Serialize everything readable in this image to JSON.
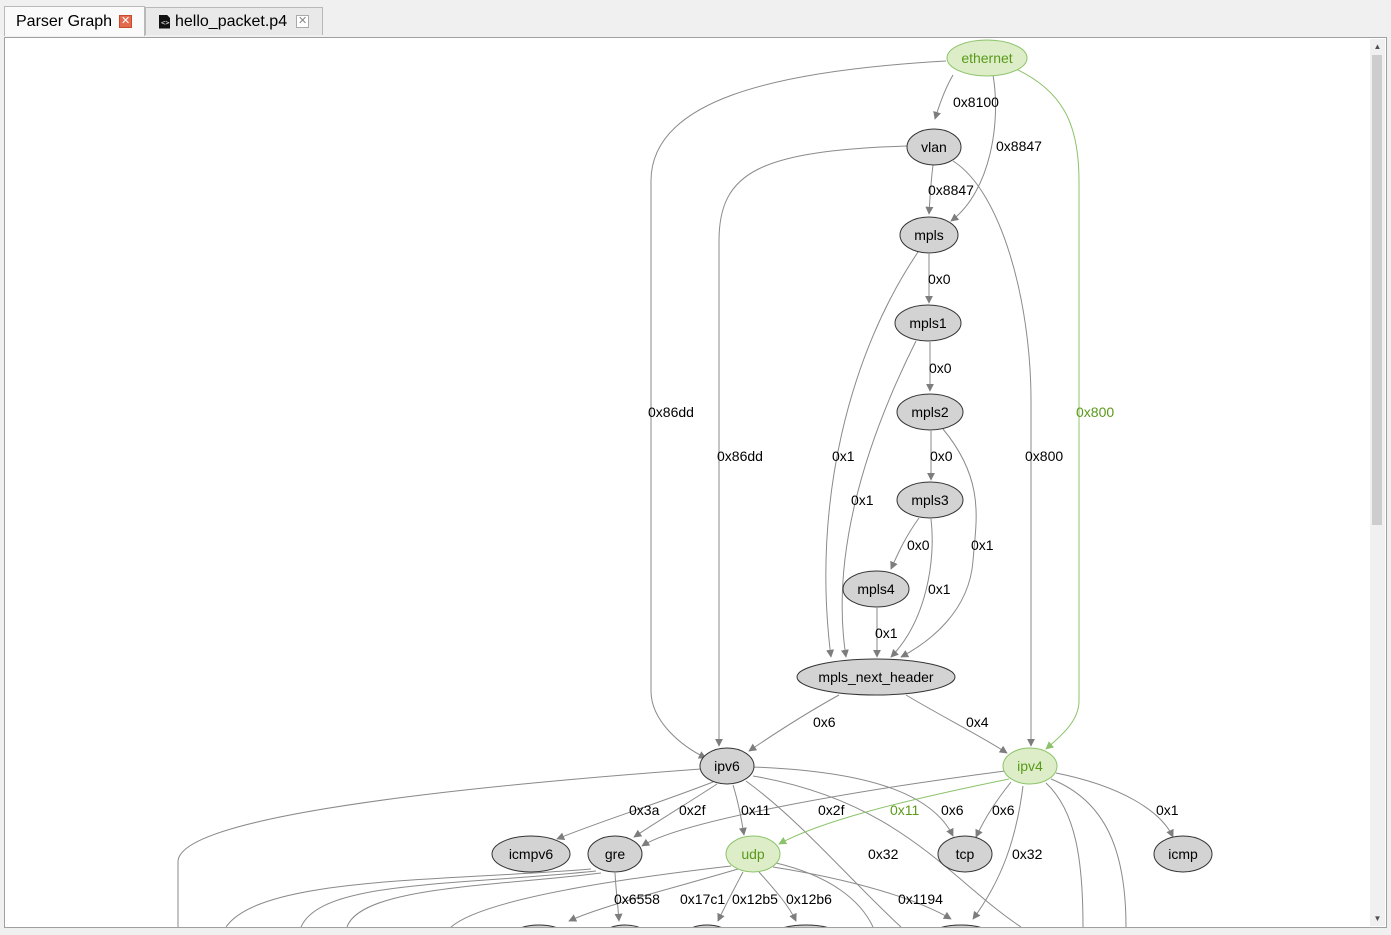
{
  "tabs": [
    {
      "label": "Parser Graph",
      "active": true
    },
    {
      "label": "hello_packet.p4",
      "active": false
    }
  ],
  "graph": {
    "accent_color": "#5a9a1a",
    "accent_fill": "#dcedc8",
    "node_fill": "#d3d3d3",
    "nodes": {
      "ethernet": "ethernet",
      "vlan": "vlan",
      "mpls": "mpls",
      "mpls1": "mpls1",
      "mpls2": "mpls2",
      "mpls3": "mpls3",
      "mpls4": "mpls4",
      "mpls_next_header": "mpls_next_header",
      "ipv6": "ipv6",
      "ipv4": "ipv4",
      "icmpv6": "icmpv6",
      "gre": "gre",
      "udp": "udp",
      "tcp": "tcp",
      "icmp": "icmp"
    },
    "edges": {
      "eth_vlan": "0x8100",
      "eth_mpls": "0x8847",
      "eth_ipv6": "0x86dd",
      "eth_ipv4": "0x800",
      "vlan_mpls": "0x8847",
      "vlan_ipv6": "0x86dd",
      "vlan_ipv4": "0x800",
      "mpls_mpls1": "0x0",
      "mpls_next": "0x1",
      "mpls1_mpls2": "0x0",
      "mpls1_next": "0x1",
      "mpls2_mpls3": "0x0",
      "mpls2_next": "0x1",
      "mpls3_mpls4": "0x0",
      "mpls3_next": "0x1",
      "mpls4_next": "0x1",
      "next_ipv6": "0x6",
      "next_ipv4": "0x4",
      "ipv6_icmpv6": "0x3a",
      "ipv6_gre": "0x2f",
      "ipv6_udp": "0x11",
      "ipv6_tcp": "0x6",
      "ipv6_x": "0x32",
      "ipv4_gre": "0x2f",
      "ipv4_udp": "0x11",
      "ipv4_tcp": "0x6",
      "ipv4_x": "0x32",
      "ipv4_icmp": "0x1",
      "gre_x": "0x6558",
      "udp_a": "0x17c1",
      "udp_b": "0x12b5",
      "udp_c": "0x12b6",
      "udp_d": "0x1194"
    }
  }
}
